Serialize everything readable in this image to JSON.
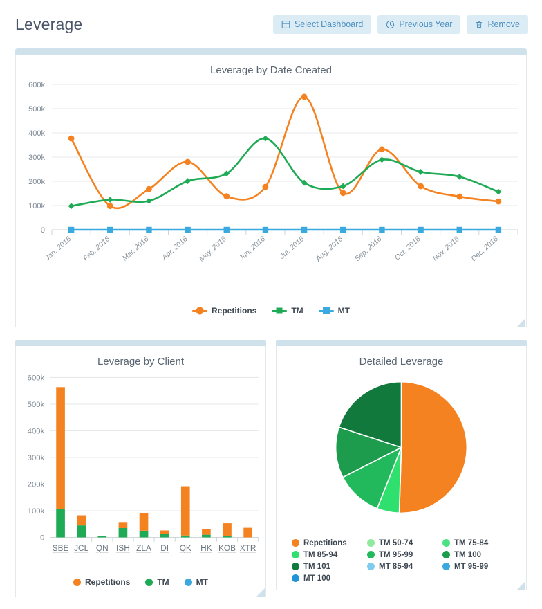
{
  "header": {
    "title": "Leverage",
    "buttons": [
      {
        "label": "Select Dashboard",
        "icon": "dashboard-icon"
      },
      {
        "label": "Previous Year",
        "icon": "clock-icon"
      },
      {
        "label": "Remove",
        "icon": "trash-icon"
      }
    ]
  },
  "colors": {
    "repetitions": "#f58220",
    "tm": "#1faa55",
    "mt": "#3aa9e0",
    "panel_top": "#cfe2ec",
    "btn_bg": "#dcecf5",
    "btn_text": "#4d8fc0",
    "grid": "#e6e9eb"
  },
  "panels": {
    "line": {
      "title": "Leverage by Date Created"
    },
    "bar": {
      "title": "Leverage by Client"
    },
    "pie": {
      "title": "Detailed Leverage"
    }
  },
  "chart_data": [
    {
      "type": "line",
      "title": "Leverage by Date Created",
      "xlabel": "",
      "ylabel": "",
      "ylim": [
        0,
        600000
      ],
      "yticks": [
        0,
        100000,
        200000,
        300000,
        400000,
        500000,
        600000
      ],
      "ytick_labels": [
        "0",
        "100k",
        "200k",
        "300k",
        "400k",
        "500k",
        "600k"
      ],
      "grid": true,
      "legend_position": "bottom",
      "categories": [
        "Jan, 2016",
        "Feb, 2016",
        "Mar, 2016",
        "Apr, 2016",
        "May, 2016",
        "Jun, 2016",
        "Jul, 2016",
        "Aug, 2016",
        "Sep, 2016",
        "Oct, 2016",
        "Nov, 2016",
        "Dec, 2016"
      ],
      "series": [
        {
          "name": "Repetitions",
          "color": "#f58220",
          "marker": "circle",
          "values": [
            377000,
            98000,
            168000,
            280000,
            138000,
            177000,
            549000,
            152000,
            332000,
            180000,
            137000,
            117000
          ]
        },
        {
          "name": "TM",
          "color": "#1faa55",
          "marker": "diamond",
          "values": [
            98000,
            124000,
            119000,
            201000,
            232000,
            377000,
            194000,
            180000,
            289000,
            239000,
            219000,
            157000
          ]
        },
        {
          "name": "MT",
          "color": "#3aa9e0",
          "marker": "square",
          "values": [
            0,
            0,
            0,
            0,
            0,
            0,
            0,
            0,
            0,
            0,
            0,
            0
          ]
        }
      ]
    },
    {
      "type": "bar",
      "title": "Leverage by Client",
      "stacked": true,
      "xlabel": "",
      "ylabel": "",
      "ylim": [
        0,
        600000
      ],
      "yticks": [
        0,
        100000,
        200000,
        300000,
        400000,
        500000,
        600000
      ],
      "ytick_labels": [
        "0",
        "100k",
        "200k",
        "300k",
        "400k",
        "500k",
        "600k"
      ],
      "grid": true,
      "legend_position": "bottom",
      "categories": [
        "SBE",
        "JCL",
        "QN",
        "ISH",
        "ZLA",
        "DI",
        "QK",
        "HK",
        "KOB",
        "XTR"
      ],
      "series": [
        {
          "name": "Repetitions",
          "color": "#f58220",
          "values": [
            458000,
            38000,
            0,
            20000,
            65000,
            13000,
            185000,
            22000,
            48000,
            36000
          ]
        },
        {
          "name": "TM",
          "color": "#1faa55",
          "values": [
            106000,
            45000,
            4000,
            35000,
            25000,
            13000,
            7000,
            10000,
            5000,
            0
          ]
        },
        {
          "name": "MT",
          "color": "#3aa9e0",
          "values": [
            0,
            0,
            0,
            0,
            0,
            0,
            0,
            0,
            0,
            0
          ]
        }
      ]
    },
    {
      "type": "pie",
      "title": "Detailed Leverage",
      "legend_position": "bottom",
      "start_angle": 0,
      "labels": [
        "Repetitions",
        "TM 50-74",
        "TM 75-84",
        "TM 85-94",
        "TM 95-99",
        "TM 100",
        "TM 101",
        "MT 85-94",
        "MT 95-99",
        "MT 100"
      ],
      "colors": [
        "#f58220",
        "#90ea9e",
        "#4ce283",
        "#2fe06e",
        "#22b95c",
        "#1d9c4e",
        "#12793c",
        "#7fcdee",
        "#3aa9e0",
        "#1f94d6"
      ],
      "values": [
        50.5,
        0,
        0,
        5.5,
        11.5,
        12.5,
        20.0,
        0,
        0,
        0
      ]
    }
  ],
  "line_legend": [
    {
      "label": "Repetitions",
      "color": "#f58220",
      "marker": "circle"
    },
    {
      "label": "TM",
      "color": "#1faa55",
      "marker": "diamond"
    },
    {
      "label": "MT",
      "color": "#3aa9e0",
      "marker": "square"
    }
  ],
  "bar_legend": [
    {
      "label": "Repetitions",
      "color": "#f58220"
    },
    {
      "label": "TM",
      "color": "#1faa55"
    },
    {
      "label": "MT",
      "color": "#3aa9e0"
    }
  ],
  "pie_legend": [
    {
      "label": "Repetitions",
      "color": "#f58220"
    },
    {
      "label": "TM 50-74",
      "color": "#90ea9e"
    },
    {
      "label": "TM 75-84",
      "color": "#4ce283"
    },
    {
      "label": "TM 85-94",
      "color": "#2fe06e"
    },
    {
      "label": "TM 95-99",
      "color": "#22b95c"
    },
    {
      "label": "TM 100",
      "color": "#1d9c4e"
    },
    {
      "label": "TM 101",
      "color": "#12793c"
    },
    {
      "label": "MT 85-94",
      "color": "#7fcdee"
    },
    {
      "label": "MT 95-99",
      "color": "#3aa9e0"
    },
    {
      "label": "MT 100",
      "color": "#1f94d6"
    }
  ]
}
